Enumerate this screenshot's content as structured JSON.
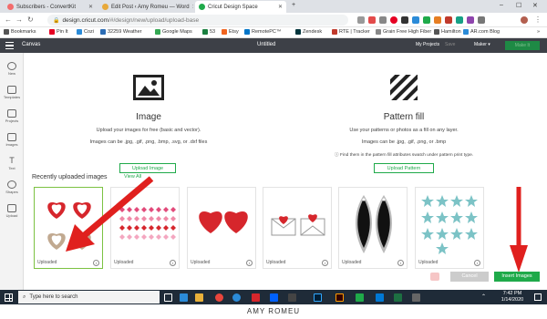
{
  "browser": {
    "tabs": [
      {
        "label": "Subscribers - ConvertKit",
        "color": "#f36c6c"
      },
      {
        "label": "Edit Post ‹ Amy Romeu — Word",
        "color": "#e8a93a"
      },
      {
        "label": "Cricut Design Space",
        "color": "#1faa4a"
      }
    ],
    "new_tab": "+",
    "address": {
      "domain": "design.cricut.com",
      "path": "/#/design/new/upload/upload-base"
    },
    "bookmarks": [
      {
        "label": "Bookmarks",
        "color": "#555"
      },
      {
        "label": "Pin It",
        "color": "#e60023"
      },
      {
        "label": "Cozi",
        "color": "#2b8bd8"
      },
      {
        "label": "32259 Weather",
        "color": "#2c6db5"
      },
      {
        "label": "Google Maps",
        "color": "#34a853"
      },
      {
        "label": "53",
        "color": "#1a7f3f"
      },
      {
        "label": "Etsy",
        "color": "#f1641e"
      },
      {
        "label": "RemotePC™",
        "color": "#0074c7"
      },
      {
        "label": "Zendesk",
        "color": "#03363d"
      },
      {
        "label": "RTE | Tracker",
        "color": "#c0392b"
      },
      {
        "label": "Grain Free High Fiber",
        "color": "#888"
      },
      {
        "label": "Hamilton",
        "color": "#555"
      },
      {
        "label": "AR.com Blog",
        "color": "#2b8bd8"
      }
    ],
    "more": "»"
  },
  "app": {
    "menu_label": "Canvas",
    "doc_title": "Untitled",
    "my_projects": "My Projects",
    "save": "Save",
    "maker": "Maker",
    "make_it": "Make It",
    "sidebar": [
      "New",
      "Templates",
      "Projects",
      "Images",
      "Text",
      "Shapes",
      "Upload"
    ],
    "image_section": {
      "title": "Image",
      "line1": "Upload your images for free (basic and vector).",
      "line2": "Images can be .jpg, .gif, .png, .bmp, .svg, or .dxf files",
      "button": "Upload Image"
    },
    "pattern_section": {
      "title": "Pattern fill",
      "line1": "Use your patterns or photos as a fill on any layer.",
      "line2": "Images can be .jpg, .gif, .png, or .bmp",
      "line3": "Find them in the pattern fill attributes swatch under pattern print type.",
      "button": "Upload Pattern"
    },
    "recent_title": "Recently uploaded images",
    "view_all": "View All",
    "card_label": "Uploaded",
    "card_count": 6,
    "cancel": "Cancel",
    "insert": "Insert Images"
  },
  "taskbar": {
    "search_placeholder": "Type here to search",
    "time": "7:42 PM",
    "date": "1/14/2020"
  },
  "caption": "AMY ROMEU",
  "colors": {
    "accent_green": "#1faa4a",
    "arrow_red": "#e0201e",
    "header_dark": "#3d4047"
  }
}
